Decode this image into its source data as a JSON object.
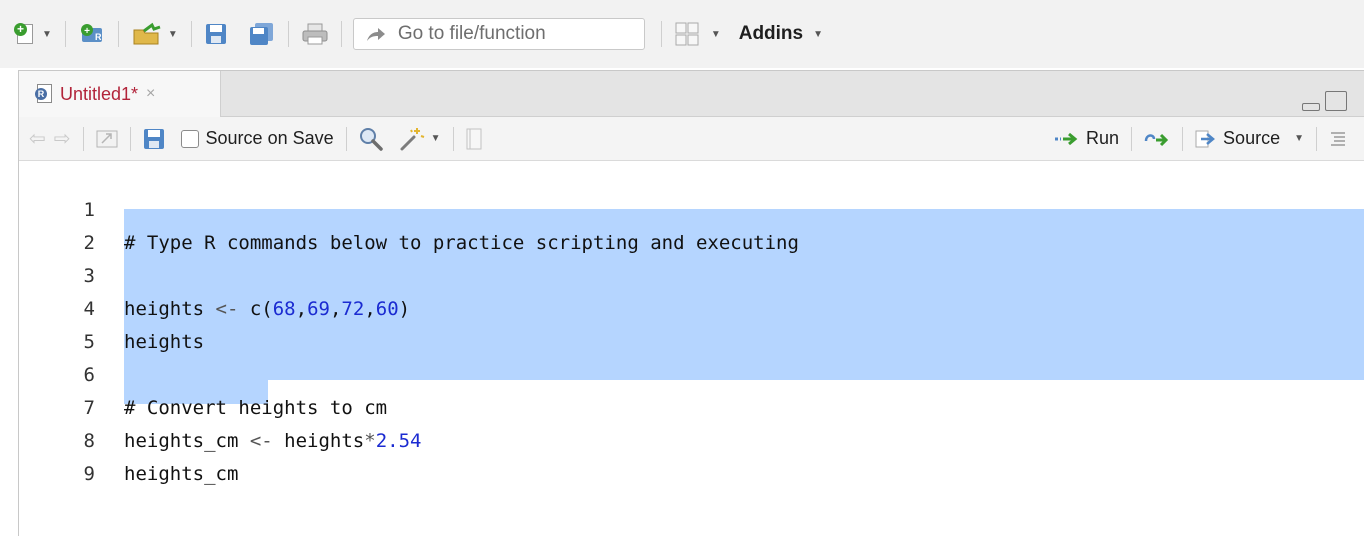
{
  "main_toolbar": {
    "goto_placeholder": "Go to file/function",
    "addins_label": "Addins"
  },
  "editor": {
    "tab": {
      "title": "Untitled1*",
      "close_glyph": "×"
    },
    "source_toolbar": {
      "source_on_save_label": "Source on Save",
      "source_on_save_checked": false,
      "run_label": "Run",
      "source_label": "Source"
    },
    "lines": [
      {
        "num": "1",
        "text": "# Type R commands below to practice scripting and executing"
      },
      {
        "num": "2",
        "text": ""
      },
      {
        "num": "3",
        "text": "heights <- c(68,69,72,60)"
      },
      {
        "num": "4",
        "text": "heights"
      },
      {
        "num": "5",
        "text": ""
      },
      {
        "num": "6",
        "text": "# Convert heights to cm"
      },
      {
        "num": "7",
        "text": "heights_cm <- heights*2.54"
      },
      {
        "num": "8",
        "text": "heights_cm"
      },
      {
        "num": "9",
        "text": ""
      }
    ],
    "selection": {
      "from_line": 3,
      "to_line": 8,
      "to_line_end_text": "heights_cm"
    }
  },
  "colors": {
    "selection": "#b5d5ff",
    "comment": "#3f7f3f",
    "number": "#1b2bd1",
    "tab_title": "#b2243a"
  },
  "icons": [
    "new-file-icon",
    "caret-down-icon",
    "new-project-icon",
    "open-file-icon",
    "save-icon",
    "save-all-icon",
    "print-icon",
    "goto-arrow-icon",
    "grid-layout-icon",
    "back-arrow-icon",
    "forward-arrow-icon",
    "show-in-window-icon",
    "search-icon",
    "magic-wand-icon",
    "compile-notebook-icon",
    "run-arrow-icon",
    "rerun-icon",
    "source-arrow-icon",
    "outline-icon"
  ]
}
